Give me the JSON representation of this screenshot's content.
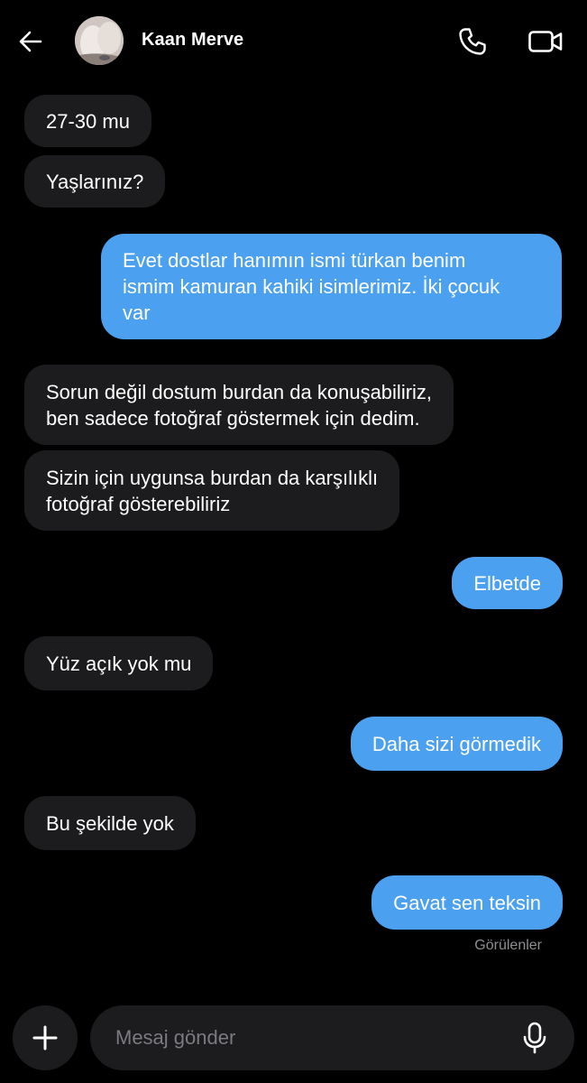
{
  "header": {
    "contact_name": "Kaan Merve",
    "back_icon": "arrow-left-icon",
    "call_icon": "phone-icon",
    "video_icon": "video-camera-icon"
  },
  "messages": [
    {
      "direction": "incoming",
      "text": "27-30 mu"
    },
    {
      "direction": "incoming",
      "text": "Yaşlarınız?"
    },
    {
      "direction": "outgoing",
      "text": "Evet dostlar hanımın ismi türkan benim\nismim kamuran kahiki isimlerimiz. İki çocuk\nvar"
    },
    {
      "direction": "incoming",
      "text": "Sorun değil dostum burdan da konuşabiliriz,\nben sadece fotoğraf göstermek için dedim."
    },
    {
      "direction": "incoming",
      "text": "Sizin için uygunsa burdan da karşılıklı\nfotoğraf gösterebiliriz"
    },
    {
      "direction": "outgoing",
      "text": "Elbetde"
    },
    {
      "direction": "incoming",
      "text": "Yüz açık yok mu"
    },
    {
      "direction": "outgoing",
      "text": "Daha sizi görmedik"
    },
    {
      "direction": "incoming",
      "text": "Bu şekilde yok"
    },
    {
      "direction": "outgoing",
      "text": "Gavat sen teksin"
    }
  ],
  "status": {
    "seen_label": "Görülenler"
  },
  "composer": {
    "placeholder": "Mesaj gönder",
    "value": "",
    "add_icon": "plus-icon",
    "mic_icon": "microphone-icon"
  },
  "colors": {
    "background": "#000000",
    "incoming_bubble": "#1c1c1e",
    "outgoing_bubble": "#4ba0ef",
    "muted_text": "#8e8e93"
  }
}
